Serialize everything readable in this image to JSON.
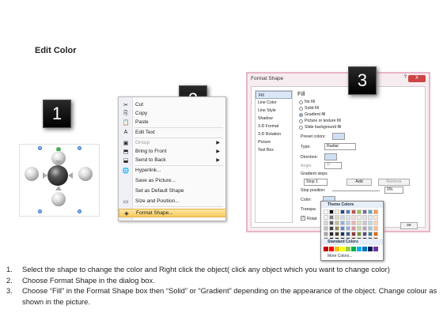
{
  "title": "Edit Color",
  "steps": [
    "1",
    "2",
    "3"
  ],
  "menu": {
    "items": [
      {
        "icon": "✂",
        "label": "Cut",
        "disabled": false,
        "submenu": false
      },
      {
        "icon": "⎘",
        "label": "Copy",
        "disabled": false,
        "submenu": false
      },
      {
        "icon": "📋",
        "label": "Paste",
        "disabled": false,
        "submenu": false
      },
      {
        "icon": "A",
        "label": "Edit Text",
        "disabled": false,
        "submenu": false
      },
      {
        "icon": "▣",
        "label": "Group",
        "disabled": true,
        "submenu": true
      },
      {
        "icon": "⬒",
        "label": "Bring to Front",
        "disabled": false,
        "submenu": true
      },
      {
        "icon": "⬓",
        "label": "Send to Back",
        "disabled": false,
        "submenu": true
      },
      {
        "icon": "🌐",
        "label": "Hyperlink...",
        "disabled": false,
        "submenu": false
      },
      {
        "icon": "",
        "label": "Save as Picture...",
        "disabled": false,
        "submenu": false
      },
      {
        "icon": "",
        "label": "Set as Default Shape",
        "disabled": false,
        "submenu": false
      },
      {
        "icon": "▭",
        "label": "Size and Position...",
        "disabled": false,
        "submenu": false
      },
      {
        "icon": "◈",
        "label": "Format Shape...",
        "disabled": false,
        "submenu": false,
        "selected": true
      }
    ]
  },
  "dialog": {
    "title": "Format Shape",
    "help": "?",
    "close": "X",
    "nav": [
      "Fill",
      "Line Color",
      "Line Style",
      "Shadow",
      "3-D Format",
      "3-D Rotation",
      "Picture",
      "Text Box"
    ],
    "fill_heading": "Fill",
    "options": [
      "No fill",
      "Solid fill",
      "Gradient fill",
      "Picture or texture fill",
      "Slide background fill"
    ],
    "preset_label": "Preset colors:",
    "type_label": "Type:",
    "type_value": "Radial",
    "direction_label": "Direction:",
    "angle_label": "Angle:",
    "angle_value": "0°",
    "stops_label": "Gradient stops",
    "stop_value": "Stop 1",
    "add_label": "Add",
    "remove_label": "Remove",
    "stop_position_label": "Stop position:",
    "stop_position_value": "0%",
    "color_label": "Color:",
    "transparency_label": "Transpa",
    "rotate_label": "Rotat",
    "close_btn": "se"
  },
  "palette": {
    "theme_label": "Theme Colors",
    "standard_label": "Standard Colors",
    "more_label": "More Colors...",
    "theme_top": [
      "#ffffff",
      "#000000",
      "#eeece1",
      "#1f497d",
      "#4f81bd",
      "#c0504d",
      "#9bbb59",
      "#8064a2",
      "#4bacc6",
      "#f79646"
    ],
    "theme_rows": [
      [
        "#f2f2f2",
        "#7f7f7f",
        "#ddd9c3",
        "#c6d9f0",
        "#dbe5f1",
        "#f2dcdb",
        "#ebf1dd",
        "#e5e0ec",
        "#dbeef3",
        "#fdeada"
      ],
      [
        "#d8d8d8",
        "#595959",
        "#c4bd97",
        "#8db3e2",
        "#b8cce4",
        "#e5b9b7",
        "#d7e3bc",
        "#ccc1d9",
        "#b7dde8",
        "#fbd5b5"
      ],
      [
        "#bfbfbf",
        "#3f3f3f",
        "#938953",
        "#548dd4",
        "#95b3d7",
        "#d99694",
        "#c3d69b",
        "#b2a2c7",
        "#92cddc",
        "#fac08f"
      ],
      [
        "#a5a5a5",
        "#262626",
        "#494429",
        "#17365d",
        "#366092",
        "#953734",
        "#76923c",
        "#5f497a",
        "#31859b",
        "#e36c09"
      ],
      [
        "#7f7f7f",
        "#0c0c0c",
        "#1d1b10",
        "#0f243e",
        "#244061",
        "#632423",
        "#4f6128",
        "#3f3151",
        "#205867",
        "#974806"
      ]
    ],
    "standard": [
      "#c00000",
      "#ff0000",
      "#ffc000",
      "#ffff00",
      "#92d050",
      "#00b050",
      "#00b0f0",
      "#0070c0",
      "#002060",
      "#7030a0"
    ]
  },
  "instructions": [
    {
      "num": "1.",
      "text": "Select the shape to change the color and Right click the object( click any object which you want to change color)"
    },
    {
      "num": "2.",
      "text": "Choose Format Shape in the dialog box."
    },
    {
      "num": "3.",
      "text": "Choose “Fill” in the Format Shape box then “Solid” or “Gradient” depending on the appearance of the object. Change colour as shown in the picture."
    }
  ]
}
